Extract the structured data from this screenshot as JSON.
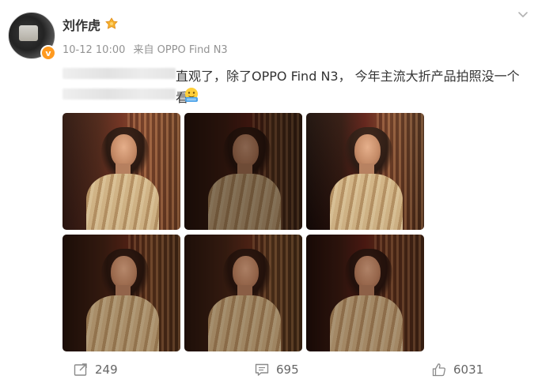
{
  "post": {
    "username": "刘作虎",
    "meta": {
      "time": "10-12 10:00",
      "source": "来自 OPPO Find N3"
    },
    "text_line1": "直观了，除了OPPO Find N3， 今年主流大折产品拍照没一个",
    "text_line2": "看"
  },
  "photos": [
    {
      "label": "photo-1"
    },
    {
      "label": "photo-2"
    },
    {
      "label": "photo-3"
    },
    {
      "label": "photo-4"
    },
    {
      "label": "photo-5"
    },
    {
      "label": "photo-6"
    }
  ],
  "actions": {
    "repost_count": "249",
    "comment_count": "695",
    "like_count": "6031"
  },
  "colors": {
    "meta_gray": "#939393",
    "verified_orange": "#ff9a1f"
  },
  "icons": [
    "avatar",
    "verified-icon",
    "gold-badge-icon",
    "more-chevron-icon",
    "emoji-icon",
    "repost-icon",
    "comment-icon",
    "like-icon"
  ]
}
